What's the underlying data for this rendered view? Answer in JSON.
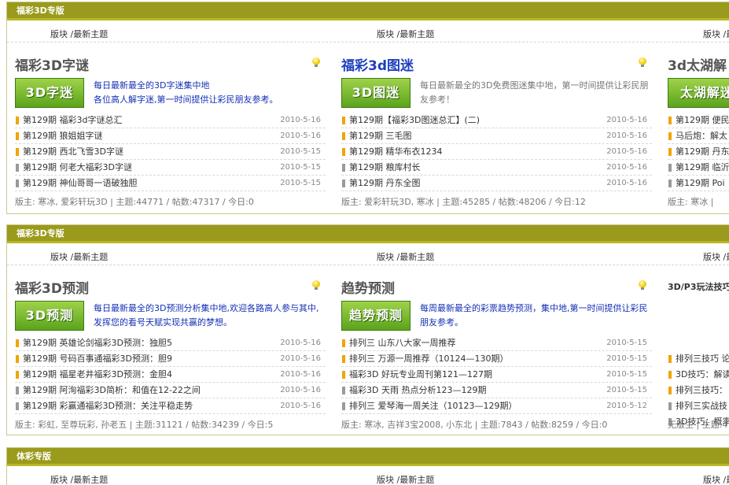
{
  "sections": [
    {
      "header": "福彩3D专版",
      "tag_label": "版块",
      "tag_sep": "/",
      "tag_latest": "最新主题",
      "cols": [
        {
          "title": "福彩3D字谜",
          "banner": "3D字迷",
          "desc": "每日最新最全的3D字迷集中地\n各位高人解字迷,第一时间提供让彩民朋友参考。",
          "posts": [
            {
              "text": "第129期  福彩3d字谜总汇",
              "date": "2010-5-16",
              "mark": "orange"
            },
            {
              "text": "第129期  狼姐姐字谜",
              "date": "2010-5-16",
              "mark": "orange"
            },
            {
              "text": "第129期  西北飞雪3D字谜",
              "date": "2010-5-15",
              "mark": "orange"
            },
            {
              "text": "第129期  何老大福彩3D字谜",
              "date": "2010-5-15",
              "mark": "grey"
            },
            {
              "text": "第129期  神仙哥哥一语破独胆",
              "date": "2010-5-15",
              "mark": "grey"
            }
          ],
          "footer": "版主: 寒冰, 爱彩轩玩3D | 主题:44771 / 帖数:47317 / 今日:0"
        },
        {
          "title": "福彩3d图迷",
          "banner": "3D图迷",
          "desc": "每日最新最全的3D免费图迷集中地，第一时间提供让彩民朋友参考！",
          "posts": [
            {
              "text": "第129期【福彩3D图迷总汇】(二)",
              "date": "2010-5-16",
              "mark": "orange"
            },
            {
              "text": "第129期  三毛图",
              "date": "2010-5-16",
              "mark": "orange"
            },
            {
              "text": "第129期  精华布衣1234",
              "date": "2010-5-16",
              "mark": "orange"
            },
            {
              "text": "第129期  粮库村长",
              "date": "2010-5-16",
              "mark": "grey"
            },
            {
              "text": "第129期  丹东全图",
              "date": "2010-5-16",
              "mark": "grey"
            }
          ],
          "footer": "版主: 爱彩轩玩3D, 寒冰 | 主题:45285 / 帖数:48206 / 今日:12"
        },
        {
          "title": "3d太湖解",
          "banner": "太湖解迷",
          "posts": [
            {
              "text": "第129期  便民",
              "mark": "orange"
            },
            {
              "text": "马后炮：解太",
              "mark": "orange"
            },
            {
              "text": "第129期  丹东",
              "mark": "orange"
            },
            {
              "text": "第129期  临沂",
              "mark": "grey"
            },
            {
              "text": "第129期  Poi",
              "mark": "grey"
            }
          ],
          "footer": "版主: 寒冰 | "
        }
      ]
    },
    {
      "header": "福彩3D专版",
      "tag_label": "版块",
      "tag_sep": "/",
      "tag_latest": "最新主题",
      "cols": [
        {
          "title": "福彩3D预测",
          "banner": "3D预测",
          "desc": "每日最新最全的3D预测分析集中地,欢迎各路高人参与其中,发挥您的看号天赋实现共赢的梦想。",
          "posts": [
            {
              "text": "第129期  英雄论剑福彩3D预测：独胆5",
              "date": "2010-5-16",
              "mark": "orange"
            },
            {
              "text": "第129期  号码百事通福彩3D预测：胆9",
              "date": "2010-5-16",
              "mark": "orange"
            },
            {
              "text": "第129期  福星老井福彩3D预测：金胆4",
              "date": "2010-5-16",
              "mark": "orange"
            },
            {
              "text": "第129期  阿洵福彩3D简析：和值在12-22之间",
              "date": "2010-5-16",
              "mark": "grey"
            },
            {
              "text": "第129期  彩赢通福彩3D预测：关注平稳走势",
              "date": "2010-5-16",
              "mark": "grey"
            }
          ],
          "footer": "版主: 彩虹, 至尊玩彩, 孙老五 | 主题:31121 / 帖数:34239 / 今日:5"
        },
        {
          "title": "趋势预测",
          "banner": "趋势预测",
          "desc": "每周最新最全的彩票趋势预测，集中地,第一时间提供让彩民朋友参考。",
          "posts": [
            {
              "text": "排列三  山东八大家一周推荐",
              "date": "2010-5-15",
              "mark": "orange"
            },
            {
              "text": "排列三  万源一周推荐（10124—130期）",
              "date": "2010-5-15",
              "mark": "orange"
            },
            {
              "text": "福彩3D 好玩专业周刊第121—127期",
              "date": "2010-5-15",
              "mark": "orange"
            },
            {
              "text": "福彩3D 天雨  热点分析123—129期",
              "date": "2010-5-15",
              "mark": "grey"
            },
            {
              "text": "排列三  爱琴海一周关注（10123—129期）",
              "date": "2010-5-12",
              "mark": "grey"
            }
          ],
          "footer": "版主: 寒冰, 吉祥3宝2008, 小东北 | 主题:7843 / 帖数:8259 / 今日:0"
        },
        {
          "title": "3D/P3玩法技巧",
          "posts": [
            {
              "text": "排列三技巧  论",
              "mark": "orange"
            },
            {
              "text": "3D技巧：解读",
              "mark": "orange"
            },
            {
              "text": "排列三技巧：",
              "mark": "orange"
            },
            {
              "text": "排列三实战技",
              "mark": "grey"
            },
            {
              "text": "3D技巧：概率",
              "mark": "grey"
            }
          ],
          "footer": "无版主 | 主题:4"
        }
      ]
    },
    {
      "header": "体彩专版",
      "tag_label": "版块",
      "tag_sep": "/",
      "tag_latest": "最新主题"
    }
  ]
}
